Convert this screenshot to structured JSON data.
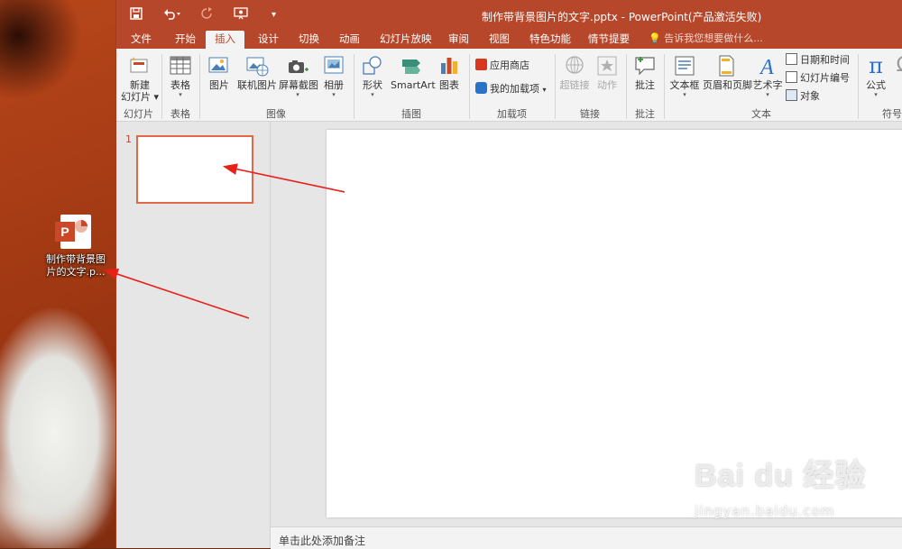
{
  "desktop": {
    "file_icon_label_line1": "制作带背景图",
    "file_icon_label_line2": "片的文字.p..."
  },
  "window": {
    "title": "制作带背景图片的文字.pptx - PowerPoint(产品激活失败)",
    "tabs": [
      {
        "label": "文件"
      },
      {
        "label": "开始"
      },
      {
        "label": "插入",
        "active": true
      },
      {
        "label": "设计"
      },
      {
        "label": "切换"
      },
      {
        "label": "动画"
      },
      {
        "label": "幻灯片放映"
      },
      {
        "label": "审阅"
      },
      {
        "label": "视图"
      },
      {
        "label": "特色功能"
      },
      {
        "label": "情节提要"
      }
    ],
    "tell_me": "告诉我您想要做什么..."
  },
  "ribbon": {
    "new_slide_line1": "新建",
    "new_slide_line2": "幻灯片",
    "group_slides": "幻灯片",
    "table": "表格",
    "group_table": "表格",
    "picture": "图片",
    "online_picture": "联机图片",
    "screenshot": "屏幕截图",
    "album": "相册",
    "group_images": "图像",
    "shapes": "形状",
    "smartart": "SmartArt",
    "chart": "图表",
    "group_illustrations": "插图",
    "store": "应用商店",
    "my_addins": "我的加载项",
    "group_addins": "加载项",
    "hyperlink": "超链接",
    "action": "动作",
    "group_links": "链接",
    "comment": "批注",
    "group_comments": "批注",
    "textbox": "文本框",
    "header_footer": "页眉和页脚",
    "wordart": "艺术字",
    "date_time": "日期和时间",
    "slide_number": "幻灯片编号",
    "object": "对象",
    "group_text": "文本",
    "equation": "公式",
    "group_symbols": "符号",
    "symbol_icon_char": "Ω"
  },
  "slides": {
    "thumbnail_number": "1"
  },
  "notes": {
    "placeholder": "单击此处添加备注"
  },
  "watermark": {
    "brand": "Bai du 经验",
    "url": "jingyan.baidu.com"
  },
  "colors": {
    "ppt_accent": "#b7472a",
    "thumbnail_border": "#e1694a",
    "arrow": "#e8201a"
  }
}
